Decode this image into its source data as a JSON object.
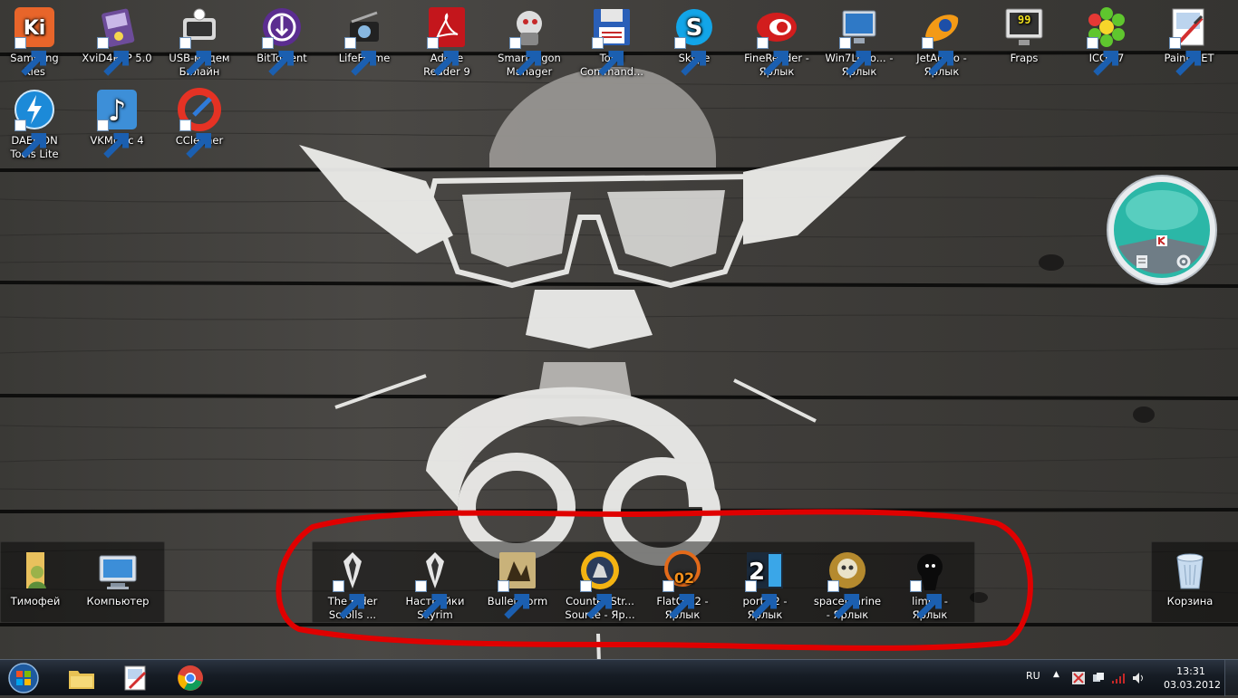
{
  "desktop": {
    "top_row": [
      {
        "label": "Samsung Kies",
        "icon": "samsung-kies-icon"
      },
      {
        "label": "XviD4PSP 5.0",
        "icon": "xvid4psp-icon"
      },
      {
        "label": "USB-модем Билайн",
        "icon": "usb-modem-icon"
      },
      {
        "label": "BitTorrent",
        "icon": "bittorrent-icon"
      },
      {
        "label": "LifeFrame",
        "icon": "lifeframe-icon"
      },
      {
        "label": "Adobe Reader 9",
        "icon": "adobe-reader-icon"
      },
      {
        "label": "SmartLogon Manager",
        "icon": "smartlogon-icon"
      },
      {
        "label": "Total Command...",
        "icon": "total-commander-icon"
      },
      {
        "label": "Skype",
        "icon": "skype-icon"
      },
      {
        "label": "FineReader - Ярлык",
        "icon": "finereader-icon"
      },
      {
        "label": "Win7Logo... - Ярлык",
        "icon": "win7logo-icon"
      },
      {
        "label": "JetAudio - Ярлык",
        "icon": "jetaudio-icon"
      },
      {
        "label": "Fraps",
        "icon": "fraps-icon"
      },
      {
        "label": "ICQ7.7",
        "icon": "icq-icon"
      },
      {
        "label": "Paint.NET",
        "icon": "paint-net-icon"
      }
    ],
    "second_row": [
      {
        "label": "DAEMON Tools Lite",
        "icon": "daemon-tools-icon"
      },
      {
        "label": "VKMusic 4",
        "icon": "vkmusic-icon"
      },
      {
        "label": "CCleaner",
        "icon": "ccleaner-icon"
      }
    ],
    "left_fence": [
      {
        "label": "Тимофей",
        "icon": "user-folder-icon"
      },
      {
        "label": "Компьютер",
        "icon": "computer-icon"
      }
    ],
    "games_fence": [
      {
        "label": "The Elder Scrolls ...",
        "icon": "skyrim-icon"
      },
      {
        "label": "Настройки Skyrim",
        "icon": "skyrim-settings-icon"
      },
      {
        "label": "Bulletstorm",
        "icon": "bulletstorm-icon"
      },
      {
        "label": "Counter-Str... Source - Яр...",
        "icon": "counter-strike-icon"
      },
      {
        "label": "FlatOut2 - Ярлык",
        "icon": "flatout2-icon"
      },
      {
        "label": "portal2 - Ярлык",
        "icon": "portal2-icon"
      },
      {
        "label": "spacemarine - Ярлык",
        "icon": "spacemarine-icon"
      },
      {
        "label": "limbo - Ярлык",
        "icon": "limbo-icon"
      }
    ],
    "right_fence": [
      {
        "label": "Корзина",
        "icon": "recycle-bin-icon"
      }
    ]
  },
  "colors": {
    "annotation": "#e00000",
    "gadget": "#2bb7a7"
  },
  "taskbar": {
    "pinned": [
      {
        "name": "explorer",
        "icon": "folder-icon"
      },
      {
        "name": "paint-net",
        "icon": "paint-net-icon"
      },
      {
        "name": "chrome",
        "icon": "chrome-icon"
      }
    ],
    "tray": {
      "language": "RU",
      "time": "13:31",
      "date": "03.03.2012"
    }
  }
}
